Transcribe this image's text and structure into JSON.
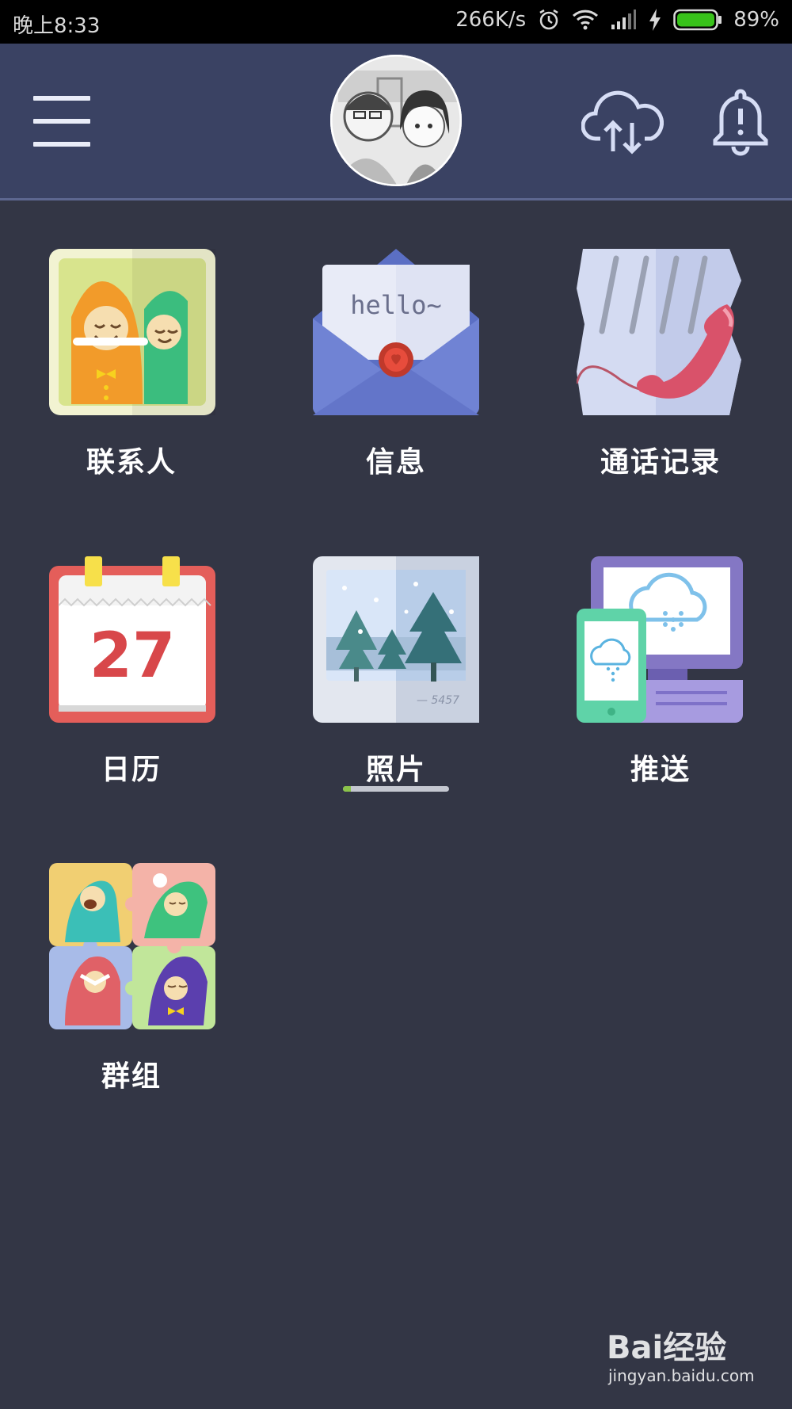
{
  "status_bar": {
    "time": "晚上8:33",
    "network_speed": "266K/s",
    "battery": "89%",
    "icons": [
      "alarm-icon",
      "wifi-icon",
      "signal-icon",
      "charging-icon",
      "battery-icon"
    ]
  },
  "header": {
    "menu_icon": "hamburger-menu-icon",
    "avatar": "profile-avatar",
    "sync_icon": "cloud-sync-icon",
    "notification_icon": "bell-icon"
  },
  "apps": [
    {
      "label": "联系人",
      "icon": "contacts-icon"
    },
    {
      "label": "信息",
      "icon": "messages-envelope-icon",
      "icon_text": "hello~"
    },
    {
      "label": "通话记录",
      "icon": "call-log-phone-icon"
    },
    {
      "label": "日历",
      "icon": "calendar-icon",
      "icon_text": "27"
    },
    {
      "label": "照片",
      "icon": "photos-icon",
      "icon_text": "— 5457"
    },
    {
      "label": "推送",
      "icon": "push-devices-icon"
    },
    {
      "label": "群组",
      "icon": "groups-icon"
    }
  ],
  "watermark": {
    "brand": "Bai经验",
    "url": "jingyan.baidu.com"
  },
  "colors": {
    "background": "#333645",
    "header": "#3a4263",
    "accent_green": "#8bc34a"
  }
}
